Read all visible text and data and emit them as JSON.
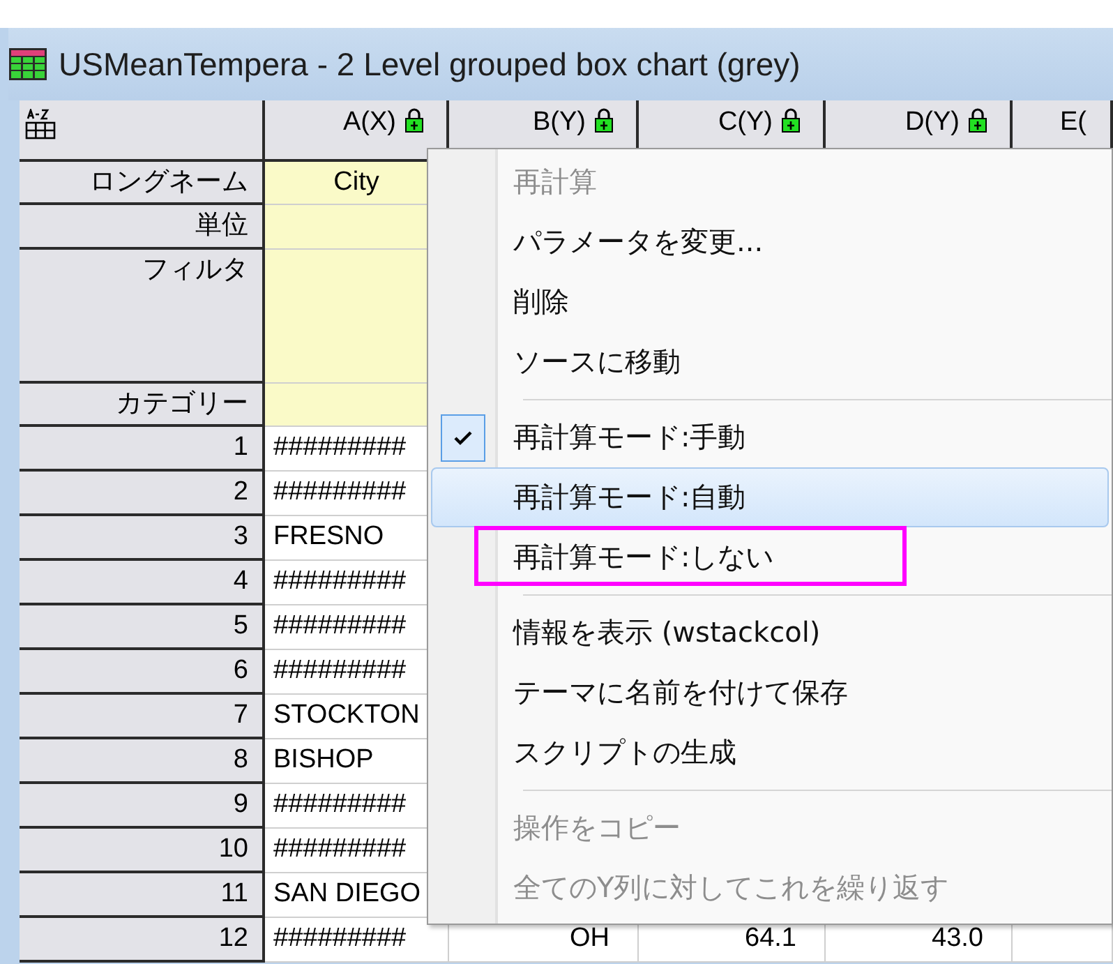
{
  "window": {
    "title": "USMeanTempera - 2 Level grouped box chart (grey)"
  },
  "columns": [
    {
      "label": "A(X)",
      "locked": true
    },
    {
      "label": "B(Y)",
      "locked": true
    },
    {
      "label": "C(Y)",
      "locked": true
    },
    {
      "label": "D(Y)",
      "locked": true
    },
    {
      "label": "E(",
      "locked": false
    }
  ],
  "label_rows": [
    {
      "label": "ロングネーム",
      "cells": [
        "City"
      ]
    },
    {
      "label": "単位",
      "cells": []
    },
    {
      "label": "フィルタ",
      "cells": []
    },
    {
      "label": "カテゴリー",
      "cells": []
    }
  ],
  "rows": [
    {
      "index": "1",
      "cells": [
        "#########"
      ]
    },
    {
      "index": "2",
      "cells": [
        "#########"
      ]
    },
    {
      "index": "3",
      "cells": [
        "FRESNO"
      ]
    },
    {
      "index": "4",
      "cells": [
        "#########"
      ]
    },
    {
      "index": "5",
      "cells": [
        "#########"
      ]
    },
    {
      "index": "6",
      "cells": [
        "#########"
      ]
    },
    {
      "index": "7",
      "cells": [
        "STOCKTON"
      ]
    },
    {
      "index": "8",
      "cells": [
        "BISHOP"
      ]
    },
    {
      "index": "9",
      "cells": [
        "#########"
      ]
    },
    {
      "index": "10",
      "cells": [
        "#########"
      ]
    },
    {
      "index": "11",
      "cells": [
        "SAN DIEGO"
      ]
    },
    {
      "index": "12",
      "cells": [
        "#########",
        "OH",
        "64.1",
        "43.0"
      ]
    }
  ],
  "context_menu": {
    "items": [
      {
        "kind": "item",
        "label": "再計算",
        "disabled": true,
        "checked": false,
        "selected": false,
        "annotated": false
      },
      {
        "kind": "item",
        "label": "パラメータを変更...",
        "disabled": false,
        "checked": false,
        "selected": false,
        "annotated": false
      },
      {
        "kind": "item",
        "label": "削除",
        "disabled": false,
        "checked": false,
        "selected": false,
        "annotated": false
      },
      {
        "kind": "item",
        "label": "ソースに移動",
        "disabled": false,
        "checked": false,
        "selected": false,
        "annotated": false
      },
      {
        "kind": "separator"
      },
      {
        "kind": "item",
        "label": "再計算モード:手動",
        "disabled": false,
        "checked": true,
        "selected": false,
        "annotated": false
      },
      {
        "kind": "item",
        "label": "再計算モード:自動",
        "disabled": false,
        "checked": false,
        "selected": true,
        "annotated": false
      },
      {
        "kind": "item",
        "label": "再計算モード:しない",
        "disabled": false,
        "checked": false,
        "selected": false,
        "annotated": true
      },
      {
        "kind": "separator"
      },
      {
        "kind": "item",
        "label": "情報を表示 (wstackcol)",
        "disabled": false,
        "checked": false,
        "selected": false,
        "annotated": false
      },
      {
        "kind": "item",
        "label": "テーマに名前を付けて保存",
        "disabled": false,
        "checked": false,
        "selected": false,
        "annotated": false
      },
      {
        "kind": "item",
        "label": "スクリプトの生成",
        "disabled": false,
        "checked": false,
        "selected": false,
        "annotated": false
      },
      {
        "kind": "separator"
      },
      {
        "kind": "item",
        "label": "操作をコピー",
        "disabled": true,
        "checked": false,
        "selected": false,
        "annotated": false
      },
      {
        "kind": "item",
        "label": "全てのY列に対してこれを繰り返す",
        "disabled": true,
        "checked": false,
        "selected": false,
        "annotated": false
      }
    ]
  }
}
